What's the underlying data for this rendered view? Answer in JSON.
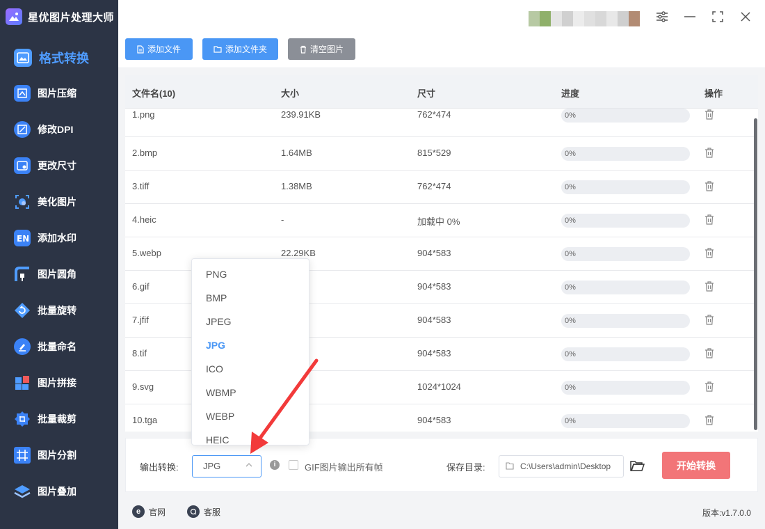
{
  "app": {
    "title": "星优图片处理大师"
  },
  "sidebar": {
    "items": [
      {
        "label": "格式转换",
        "icon": "image-convert-icon",
        "active": true
      },
      {
        "label": "图片压缩",
        "icon": "compress-icon"
      },
      {
        "label": "修改DPI",
        "icon": "dpi-icon"
      },
      {
        "label": "更改尺寸",
        "icon": "resize-icon"
      },
      {
        "label": "美化图片",
        "icon": "beautify-icon"
      },
      {
        "label": "添加水印",
        "icon": "watermark-icon"
      },
      {
        "label": "图片圆角",
        "icon": "round-corner-icon"
      },
      {
        "label": "批量旋转",
        "icon": "rotate-icon"
      },
      {
        "label": "批量命名",
        "icon": "rename-icon"
      },
      {
        "label": "图片拼接",
        "icon": "puzzle-icon"
      },
      {
        "label": "批量裁剪",
        "icon": "crop-icon"
      },
      {
        "label": "图片分割",
        "icon": "split-icon"
      },
      {
        "label": "图片叠加",
        "icon": "layers-icon"
      }
    ]
  },
  "toolbar": {
    "add_file": "添加文件",
    "add_folder": "添加文件夹",
    "clear_images": "清空图片"
  },
  "table": {
    "headers": {
      "filename": "文件名(10)",
      "size": "大小",
      "dimensions": "尺寸",
      "progress": "进度",
      "action": "操作"
    },
    "rows": [
      {
        "name": "1.png",
        "size": "239.91KB",
        "dim": "762*474",
        "progress": "0%"
      },
      {
        "name": "2.bmp",
        "size": "1.64MB",
        "dim": "815*529",
        "progress": "0%"
      },
      {
        "name": "3.tiff",
        "size": "1.38MB",
        "dim": "762*474",
        "progress": "0%"
      },
      {
        "name": "4.heic",
        "size": "-",
        "dim": "加载中 0%",
        "progress": "0%"
      },
      {
        "name": "5.webp",
        "size": "22.29KB",
        "dim": "904*583",
        "progress": "0%"
      },
      {
        "name": "6.gif",
        "size": "KB",
        "dim": "904*583",
        "progress": "0%"
      },
      {
        "name": "7.jfif",
        "size": "KB",
        "dim": "904*583",
        "progress": "0%"
      },
      {
        "name": "8.tif",
        "size": "B",
        "dim": "904*583",
        "progress": "0%"
      },
      {
        "name": "9.svg",
        "size": "KB",
        "dim": "1024*1024",
        "progress": "0%"
      },
      {
        "name": "10.tga",
        "size": "B",
        "dim": "904*583",
        "progress": "0%"
      }
    ]
  },
  "output": {
    "label": "输出转换:",
    "selected": "JPG",
    "gif_all_frames": "GIF图片输出所有帧",
    "save_dir_label": "保存目录:",
    "save_dir": "C:\\Users\\admin\\Desktop",
    "start": "开始转换"
  },
  "dropdown": {
    "options": [
      "PNG",
      "BMP",
      "JPEG",
      "JPG",
      "ICO",
      "WBMP",
      "WEBP",
      "HEIC"
    ],
    "selected_index": 3
  },
  "footer": {
    "website": "官网",
    "support": "客服",
    "version": "版本:v1.7.0.0"
  },
  "colors": {
    "accent": "#4a97f5",
    "sidebar_bg": "#2c3445",
    "start_button": "#f27578",
    "arrow": "#f23a3a"
  }
}
